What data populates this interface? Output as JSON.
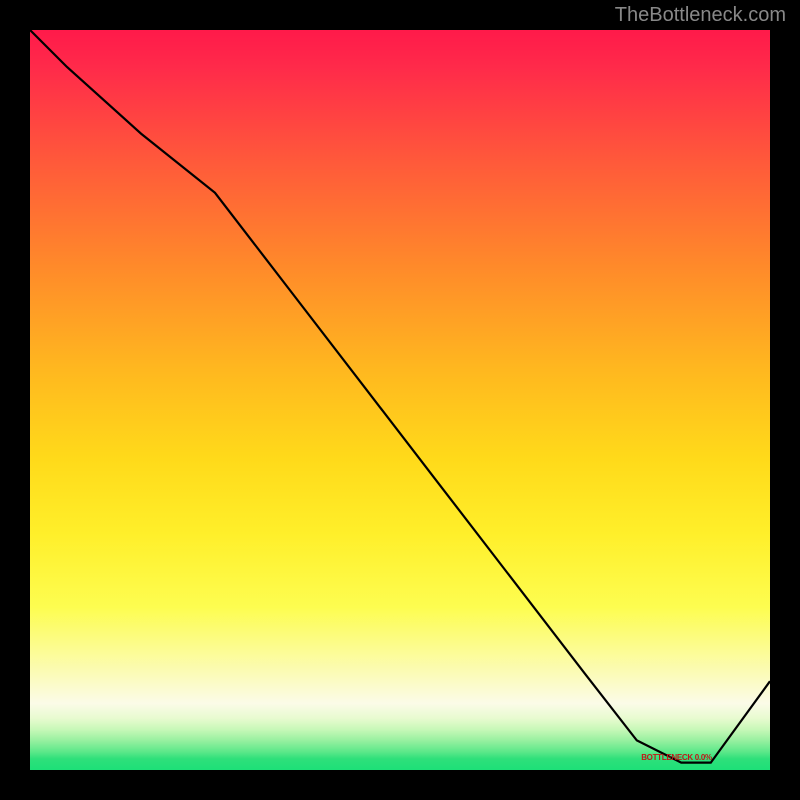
{
  "watermark": "TheBottleneck.com",
  "chart_data": {
    "type": "line",
    "title": "",
    "xlabel": "",
    "ylabel": "",
    "xlim": [
      0,
      100
    ],
    "ylim": [
      0,
      100
    ],
    "curve": {
      "x": [
        0,
        5,
        15,
        25,
        35,
        45,
        55,
        65,
        75,
        82,
        88,
        92,
        100
      ],
      "y": [
        100,
        95,
        86,
        78,
        65,
        52,
        39,
        26,
        13,
        4,
        1,
        1,
        12
      ]
    },
    "axis_label": "BOTTLENECK 0.0%",
    "background_band_stops": [
      {
        "color": "#ff1a4a",
        "pos": 0
      },
      {
        "color": "#ffda1a",
        "pos": 58
      },
      {
        "color": "#fbfbe8",
        "pos": 91
      },
      {
        "color": "#1de078",
        "pos": 100
      }
    ]
  }
}
